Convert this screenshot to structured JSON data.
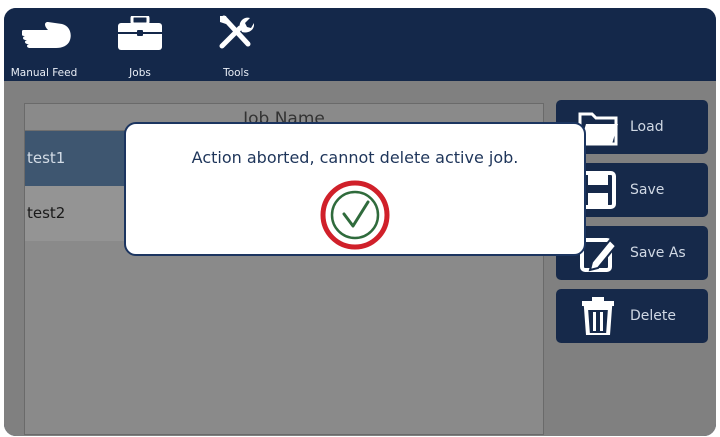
{
  "nav": [
    {
      "label": "Manual Feed",
      "icon": "hand-icon"
    },
    {
      "label": "Jobs",
      "icon": "briefcase-icon"
    },
    {
      "label": "Tools",
      "icon": "tools-icon"
    }
  ],
  "job_list": {
    "header": "Job Name",
    "rows": [
      "test1",
      "test2"
    ],
    "selected_row": "test1"
  },
  "actions": [
    {
      "label": "Load",
      "icon": "folder-icon"
    },
    {
      "label": "Save",
      "icon": "save-icon"
    },
    {
      "label": "Save As",
      "icon": "save-as-icon"
    },
    {
      "label": "Delete",
      "icon": "trash-icon"
    }
  ],
  "dialog": {
    "message": "Action aborted, cannot delete active job.",
    "confirm_icon": "checkmark-icon"
  },
  "colors": {
    "nav_bg": "#14284a",
    "selected_row": "#3e5670",
    "confirm_ring": "#d0202a",
    "confirm_check": "#2f6b3c"
  }
}
